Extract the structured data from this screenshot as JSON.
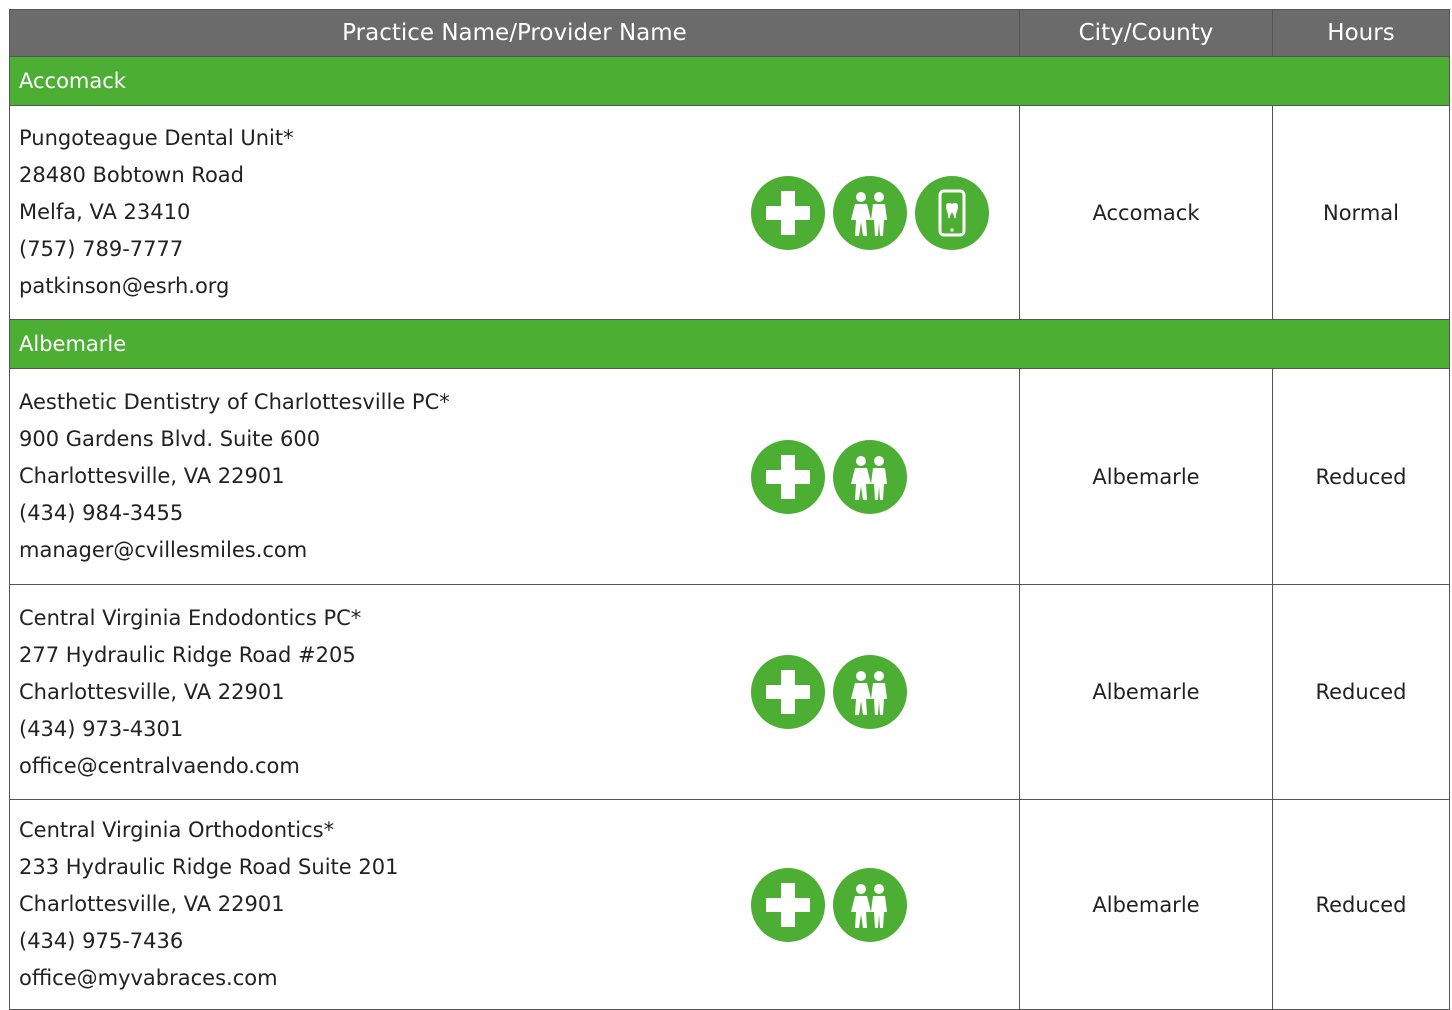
{
  "header": {
    "col1": "Practice Name/Provider Name",
    "col2": "City/County",
    "col3": "Hours"
  },
  "sections": [
    {
      "county": "Accomack",
      "entries": [
        {
          "name": "Pungoteague Dental Unit*",
          "address": "28480 Bobtown Road",
          "city": "Melfa, VA 23410",
          "phone": "(757) 789-7777",
          "email": "patkinson@esrh.org",
          "icons": [
            "medical-cross-icon",
            "children-icon",
            "mobile-tooth-icon"
          ],
          "county": "Accomack",
          "hours": "Normal"
        }
      ]
    },
    {
      "county": "Albemarle",
      "entries": [
        {
          "name": "Aesthetic Dentistry of Charlottesville PC*",
          "address": "900 Gardens Blvd. Suite 600",
          "city": "Charlottesville, VA 22901",
          "phone": "(434) 984-3455",
          "email": "manager@cvillesmiles.com",
          "icons": [
            "medical-cross-icon",
            "children-icon"
          ],
          "county": "Albemarle",
          "hours": "Reduced"
        },
        {
          "name": "Central Virginia Endodontics PC*",
          "address": "277 Hydraulic Ridge Road #205",
          "city": "Charlottesville, VA 22901",
          "phone": "(434) 973-4301",
          "email": "office@centralvaendo.com",
          "icons": [
            "medical-cross-icon",
            "children-icon"
          ],
          "county": "Albemarle",
          "hours": "Reduced"
        },
        {
          "name": "Central Virginia Orthodontics*",
          "address": "233 Hydraulic Ridge Road Suite 201",
          "city": "Charlottesville, VA 22901",
          "phone": "(434) 975-7436",
          "email": "office@myvabraces.com",
          "icons": [
            "medical-cross-icon",
            "children-icon"
          ],
          "county": "Albemarle",
          "hours": "Reduced"
        }
      ]
    }
  ],
  "colors": {
    "header_bg": "#6b6b6b",
    "accent_green": "#4caf34"
  }
}
